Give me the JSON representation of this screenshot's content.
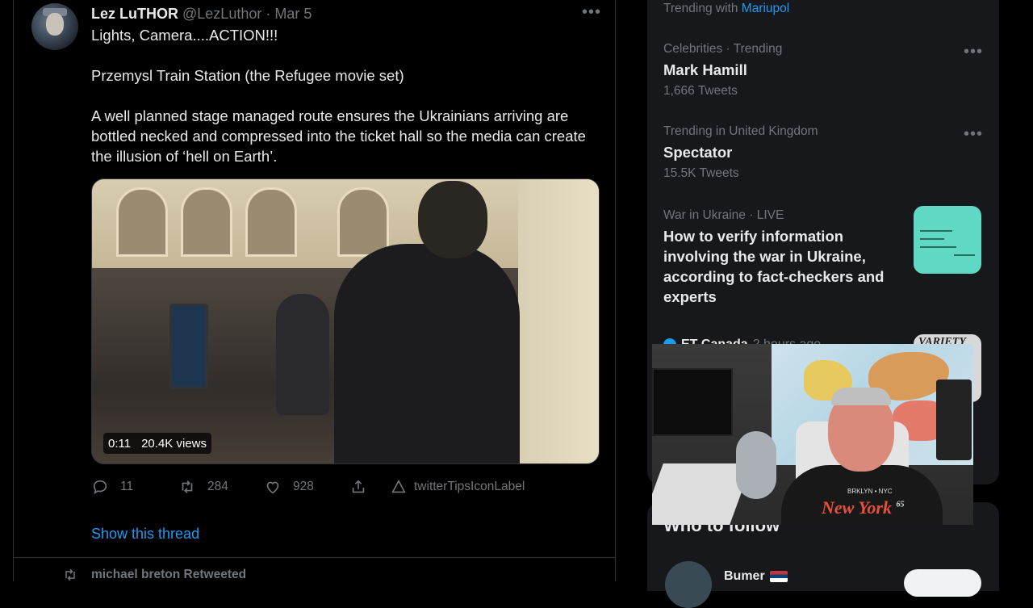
{
  "tweet": {
    "author_name": "Lez LuTHOR",
    "author_handle": "@LezLuthor",
    "separator": "·",
    "date": "Mar 5",
    "more": "•••",
    "lines": [
      "Lights, Camera....ACTION!!!",
      "Przemysl Train Station (the Refugee movie set)",
      "A well planned stage managed route ensures the Ukrainians arriving are",
      "bottled necked and compressed into the ticket hall so the media can create",
      "the illusion of ‘hell on Earth’."
    ],
    "video": {
      "duration": "0:11",
      "views": "20.4K views"
    },
    "actions": {
      "replies": "11",
      "retweets": "284",
      "likes": "928",
      "tips_label": "twitterTipsIconLabel"
    },
    "show_thread": "Show this thread",
    "retweeted_by": "michael breton Retweeted"
  },
  "sidebar": {
    "trending_with_prefix": "Trending with",
    "trending_with_link": "Mariupol",
    "trends": [
      {
        "meta": "Celebrities · Trending",
        "topic": "Mark Hamill",
        "count": "1,666 Tweets"
      },
      {
        "meta": "Trending in United Kingdom",
        "topic": "Spectator",
        "count": "15.5K Tweets"
      }
    ],
    "news": {
      "meta": "War in Ukraine · LIVE",
      "title": "How to verify information involving the war in Ukraine, according to fact-checkers and experts"
    },
    "next_news_source": "ET Canada",
    "next_news_time": "2 hours ago",
    "thumb2_logo": "VARIETY",
    "who_to_follow": "Who to follow",
    "follow_suggestion": "Bumer",
    "more": "•••"
  },
  "webcam": {
    "shirt_text": "New York",
    "shirt_top": "BRKLYN • NYC",
    "shirt_num": "65"
  },
  "colors": {
    "accent": "#1d9bf0",
    "background": "#000000",
    "panel": "#16181c",
    "muted": "#71767b"
  }
}
